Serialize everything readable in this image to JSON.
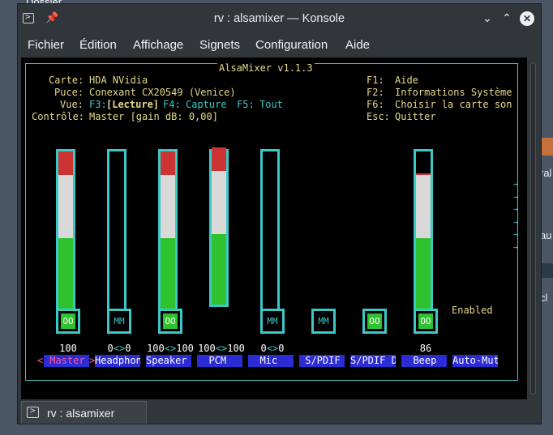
{
  "desktop": {
    "folder_label": "Dossier",
    "right_fragments": [
      "ral",
      "au",
      "cl"
    ]
  },
  "window": {
    "title": "rv : alsamixer — Konsole",
    "icons": {
      "app": "konsole-icon",
      "pin": "pin-icon"
    },
    "controls": {
      "minimize": "⌄",
      "maximize": "⌃",
      "close": "✕"
    }
  },
  "menubar": {
    "items": [
      "Fichier",
      "Édition",
      "Affichage",
      "Signets",
      "Configuration",
      "Aide"
    ]
  },
  "alsamixer": {
    "title": "AlsaMixer v1.1.3",
    "info": {
      "card_label": "Carte:",
      "card_value": "HDA NVidia",
      "chip_label": "Puce:",
      "chip_value": "Conexant CX20549 (Venice)",
      "view_label": "Vue:",
      "view_f3": "F3:",
      "view_playback": "[Lecture]",
      "view_f4": "F4:",
      "view_capture": "Capture",
      "view_f5": "F5:",
      "view_all": "Tout",
      "control_label": "Contrôle:",
      "control_value": "Master [gain dB: 0,00]"
    },
    "keys": [
      {
        "key": "F1:",
        "desc": "Aide"
      },
      {
        "key": "F2:",
        "desc": "Informations Système"
      },
      {
        "key": "F6:",
        "desc": "Choisir la carte son"
      },
      {
        "key": "Esc:",
        "desc": "Quitter"
      }
    ],
    "channels": [
      {
        "name": "Master",
        "display": " Master ",
        "selected": true,
        "level": 1.0,
        "has_bar": true,
        "state": "OO",
        "volume": "100"
      },
      {
        "name": "Headphone",
        "display": "Headphon",
        "selected": false,
        "level": 0.0,
        "has_bar": true,
        "state": "MM",
        "volume": "0<>0"
      },
      {
        "name": "Speaker",
        "display": "Speaker ",
        "selected": false,
        "level": 1.0,
        "has_bar": true,
        "state": "OO",
        "volume": "100<>100"
      },
      {
        "name": "PCM",
        "display": "  PCM   ",
        "selected": false,
        "level": 1.0,
        "has_bar": true,
        "state": "",
        "volume": "100<>100"
      },
      {
        "name": "Mic",
        "display": "  Mic   ",
        "selected": false,
        "level": 0.0,
        "has_bar": true,
        "state": "MM",
        "volume": "0<>0"
      },
      {
        "name": "S/PDIF",
        "display": " S/PDIF ",
        "selected": false,
        "level": null,
        "has_bar": false,
        "state": "MM",
        "volume": ""
      },
      {
        "name": "S/PDIF D",
        "display": "S/PDIF D",
        "selected": false,
        "level": null,
        "has_bar": false,
        "state": "OO",
        "volume": ""
      },
      {
        "name": "Beep",
        "display": "  Beep  ",
        "selected": false,
        "level": 0.86,
        "has_bar": true,
        "state": "OO",
        "volume": "86"
      },
      {
        "name": "Auto-Mute",
        "display": "Auto-Mut",
        "selected": false,
        "level": null,
        "has_bar": false,
        "state": "",
        "volume": "",
        "enum_value": "Enabled"
      }
    ],
    "left_marker": "<",
    "right_marker": ">",
    "more_arrow": "→"
  },
  "tabs": [
    {
      "label": "rv : alsamixer",
      "icon": "terminal-icon"
    }
  ],
  "colors": {
    "terminal_bg": "#000000",
    "frame": "#3cc7c8",
    "text_yellow": "#e6d98a",
    "bar_green": "#2fc22f",
    "bar_white": "#d9d9d9",
    "bar_red": "#cc3333",
    "label_bg": "#2c2cd4",
    "selected_text": "#ff5a9a",
    "window_bg": "#31363b"
  }
}
